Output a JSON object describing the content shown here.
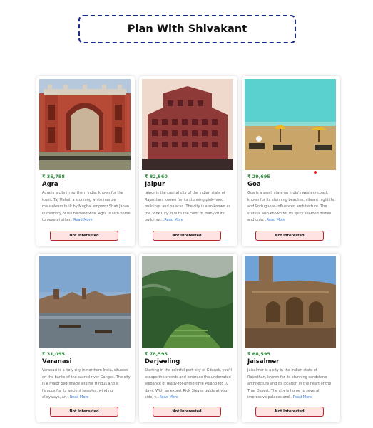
{
  "page": {
    "title": "Plan With Shivakant"
  },
  "cards": [
    {
      "price": "₹ 35,758",
      "name": "Agra",
      "image": "agra-taj-mahal-gate-image",
      "description": "Agra is a city in northern India, known for the iconic Taj Mahal, a stunning white marble mausoleum built by Mughal emperor Shah Jahan in memory of his beloved wife. Agra is also home to several other...",
      "read_more": "Read More",
      "button": "Not Interested"
    },
    {
      "price": "₹ 82,560",
      "name": "Jaipur",
      "image": "jaipur-hawa-mahal-image",
      "description": "Jaipur is the capital city of the Indian state of Rajasthan, known for its stunning pink-hued buildings and palaces. The city is also known as the 'Pink City' due to the color of many of its buildings...",
      "read_more": "Read More",
      "button": "Not Interested"
    },
    {
      "price": "₹ 29,695",
      "name": "Goa",
      "image": "goa-beach-image",
      "description": "Goa is a small state on India's western coast, known for its stunning beaches, vibrant nightlife, and Portuguese-influenced architecture. The state is also known for its spicy seafood dishes and uniq...",
      "read_more": "Read More",
      "button": "Not Interested"
    },
    {
      "price": "₹ 31,095",
      "name": "Varanasi",
      "image": "varanasi-ghats-image",
      "description": "Varanasi is a holy city in northern India, situated on the banks of the sacred river Ganges. The city is a major pilgrimage site for Hindus and is famous for its ancient temples, winding alleyways, an...",
      "read_more": "Read More",
      "button": "Not Interested"
    },
    {
      "price": "₹ 78,595",
      "name": "Darjeeling",
      "image": "darjeeling-hills-image",
      "description": "Starting in the colorful port city of Gdańsk, you'll escape the crowds and embrace the underrated elegance of ready-for-prime-time Poland for 10 days. With an expert Rick Steves guide at your side, y...",
      "read_more": "Read More",
      "button": "Not Interested"
    },
    {
      "price": "₹ 68,595",
      "name": "Jaisalmer",
      "image": "jaisalmer-haveli-image",
      "description": "Jaisalmer is a city in the Indian state of Rajasthan, known for its stunning sandstone architecture and its location in the heart of the Thar Desert. The city is home to several impressive palaces and...",
      "read_more": "Read More",
      "button": "Not Interested"
    }
  ],
  "colors": {
    "accent_border": "#1b2a8c",
    "price_green": "#2e8b3d",
    "button_bg": "#ffe3e3",
    "button_border": "#b3262d",
    "link_blue": "#3a7bd5"
  }
}
